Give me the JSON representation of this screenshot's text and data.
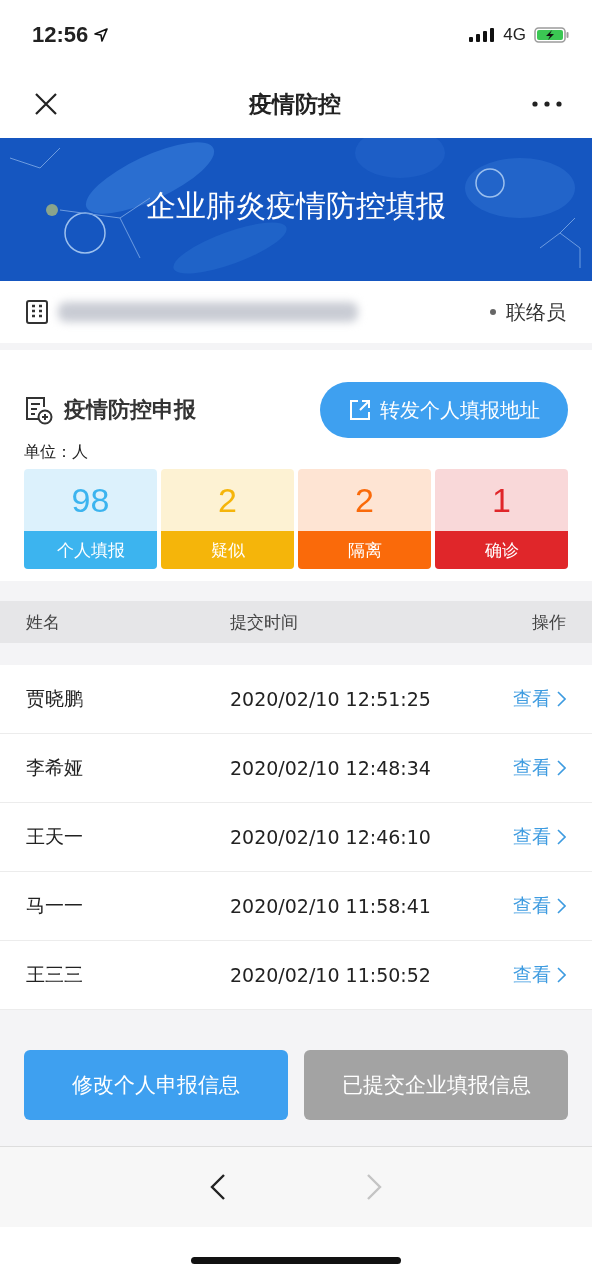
{
  "status_bar": {
    "time": "12:56",
    "network": "4G"
  },
  "nav": {
    "title": "疫情防控"
  },
  "banner": {
    "title": "企业肺炎疫情防控填报"
  },
  "company": {
    "role": "联络员"
  },
  "report": {
    "title": "疫情防控申报",
    "share_button": "转发个人填报地址",
    "unit": "单位：人",
    "stats": [
      {
        "value": "98",
        "label": "个人填报",
        "color": "#3cb4ef"
      },
      {
        "value": "2",
        "label": "疑似",
        "color": "#f5b50a"
      },
      {
        "value": "2",
        "label": "隔离",
        "color": "#fa6a0a"
      },
      {
        "value": "1",
        "label": "确诊",
        "color": "#e0262a"
      }
    ]
  },
  "table": {
    "columns": [
      "姓名",
      "提交时间",
      "操作"
    ],
    "rows": [
      {
        "name": "贾晓鹏",
        "time": "2020/02/10 12:51:25",
        "action": "查看"
      },
      {
        "name": "李希娅",
        "time": "2020/02/10 12:48:34",
        "action": "查看"
      },
      {
        "name": "王天一",
        "time": "2020/02/10 12:46:10",
        "action": "查看"
      },
      {
        "name": "马一一",
        "time": "2020/02/10 11:58:41",
        "action": "查看"
      },
      {
        "name": "王三三",
        "time": "2020/02/10 11:50:52",
        "action": "查看"
      }
    ]
  },
  "buttons": [
    {
      "label": "修改个人申报信息",
      "disabled": false
    },
    {
      "label": "已提交企业填报信息",
      "disabled": true
    }
  ],
  "toolbar": {
    "back_disabled": false,
    "forward_disabled": true
  }
}
